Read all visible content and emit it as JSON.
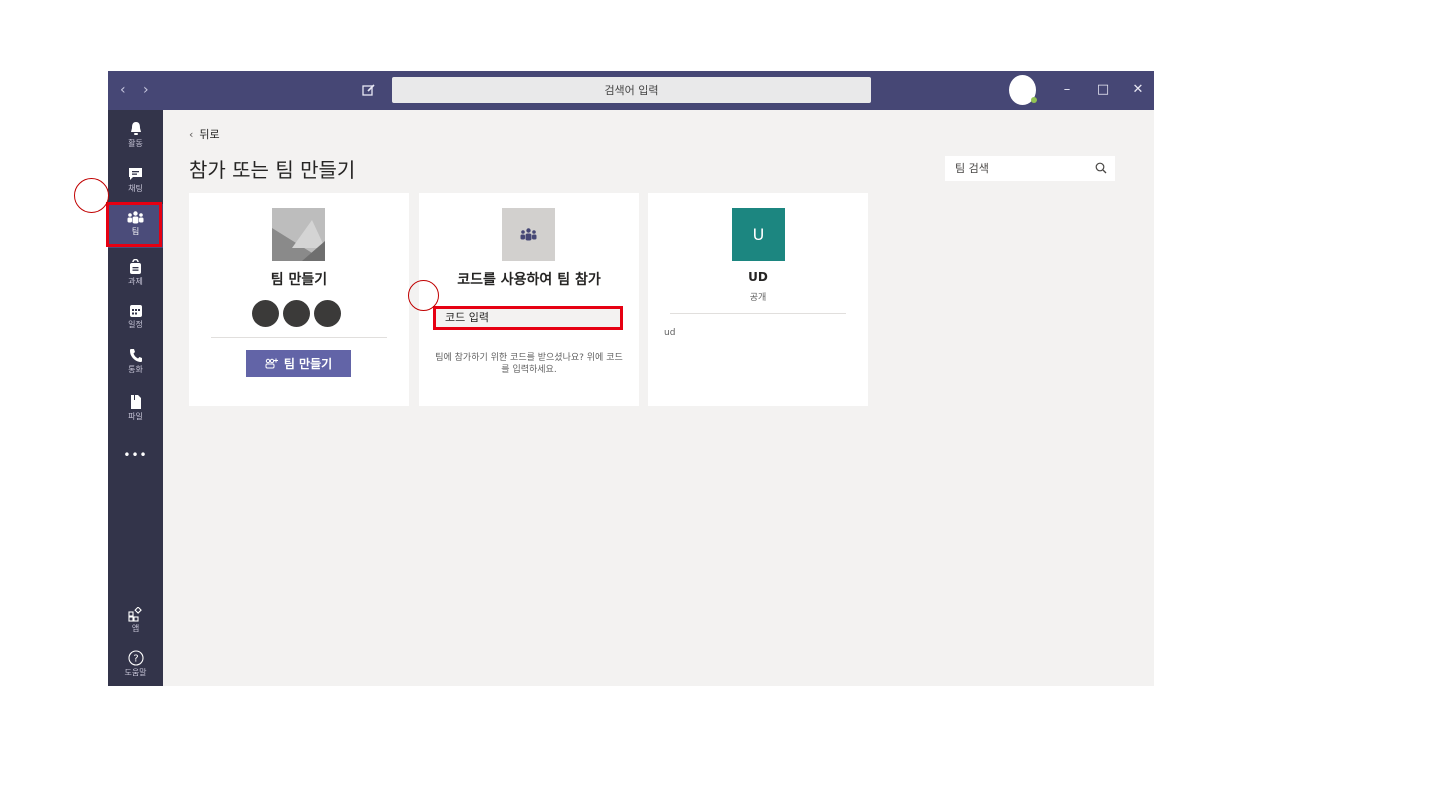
{
  "titlebar": {
    "search_placeholder": "검색어 입력"
  },
  "rail": {
    "items": [
      {
        "label": "활동",
        "icon": "bell-icon"
      },
      {
        "label": "채팅",
        "icon": "chat-icon"
      },
      {
        "label": "팀",
        "icon": "teams-icon"
      },
      {
        "label": "과제",
        "icon": "assignments-icon"
      },
      {
        "label": "일정",
        "icon": "calendar-icon"
      },
      {
        "label": "통화",
        "icon": "phone-icon"
      },
      {
        "label": "파일",
        "icon": "file-icon"
      },
      {
        "label": "•••",
        "icon": "more-icon"
      }
    ],
    "bottom": [
      {
        "label": "앱",
        "icon": "apps-icon"
      },
      {
        "label": "도움말",
        "icon": "help-icon"
      }
    ]
  },
  "main": {
    "back_label": "뒤로",
    "title": "참가 또는 팀 만들기",
    "team_search_placeholder": "팀 검색",
    "cards": {
      "create": {
        "title": "팀 만들기",
        "button_label": "팀 만들기"
      },
      "join": {
        "title": "코드를 사용하여 팀 참가",
        "input_placeholder": "코드 입력",
        "hint": "팀에 참가하기 위한 코드를 받으셨나요? 위에 코드를 입력하세요."
      },
      "team": {
        "avatar_letter": "U",
        "name": "UD",
        "visibility": "공개",
        "description": "ud"
      }
    }
  },
  "colors": {
    "titlebar": "#464775",
    "rail": "#33344a",
    "accent": "#6264a7",
    "team_avatar": "#1c8680",
    "annotation": "#e60012"
  }
}
